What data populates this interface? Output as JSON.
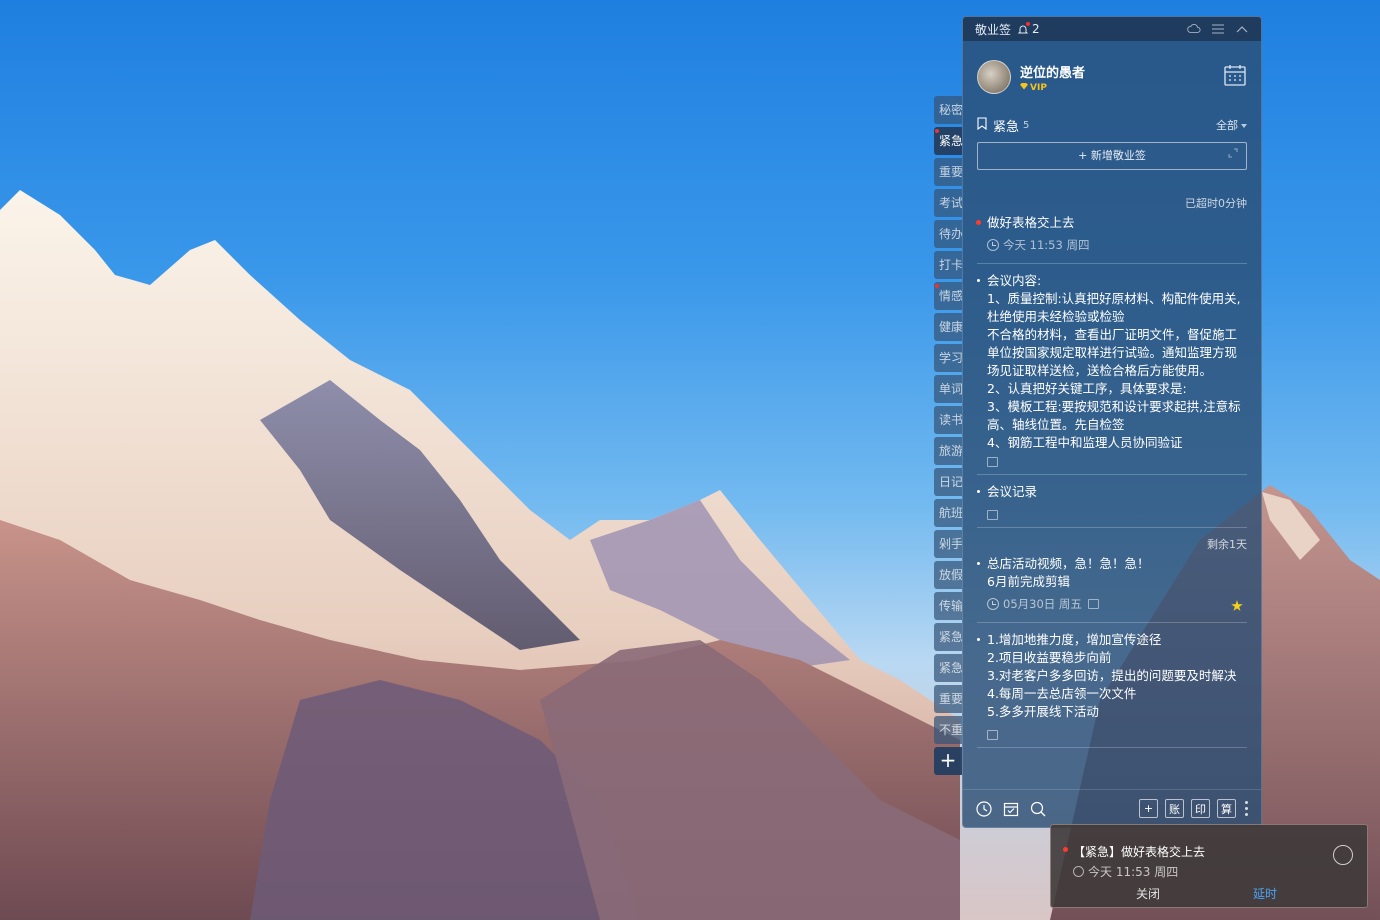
{
  "colors": {
    "accent": "#4aa3f5",
    "urgent_dot": "#ff3b30",
    "star": "#f5d218",
    "vip": "#f5c518"
  },
  "sidebar_tabs": [
    {
      "label": "秘密",
      "active": false,
      "dot": false
    },
    {
      "label": "紧急",
      "active": true,
      "dot": true
    },
    {
      "label": "重要",
      "active": false,
      "dot": false
    },
    {
      "label": "考试",
      "active": false,
      "dot": false
    },
    {
      "label": "待办",
      "active": false,
      "dot": false
    },
    {
      "label": "打卡",
      "active": false,
      "dot": false
    },
    {
      "label": "情感",
      "active": false,
      "dot": true
    },
    {
      "label": "健康",
      "active": false,
      "dot": false
    },
    {
      "label": "学习",
      "active": false,
      "dot": false
    },
    {
      "label": "单词",
      "active": false,
      "dot": false
    },
    {
      "label": "读书",
      "active": false,
      "dot": false
    },
    {
      "label": "旅游",
      "active": false,
      "dot": false
    },
    {
      "label": "日记",
      "active": false,
      "dot": false
    },
    {
      "label": "航班",
      "active": false,
      "dot": false
    },
    {
      "label": "剁手",
      "active": false,
      "dot": false
    },
    {
      "label": "放假",
      "active": false,
      "dot": false
    },
    {
      "label": "传输",
      "active": false,
      "dot": false
    },
    {
      "label": "紧急",
      "active": false,
      "dot": false
    },
    {
      "label": "紧急",
      "active": false,
      "dot": false
    },
    {
      "label": "重要",
      "active": false,
      "dot": false
    },
    {
      "label": "不重",
      "active": false,
      "dot": false
    }
  ],
  "sidebar_add": "+",
  "titlebar": {
    "app_name": "敬业签",
    "notification_count": "2",
    "icons": [
      "cloud-sync-icon",
      "menu-icon",
      "collapse-icon"
    ]
  },
  "user": {
    "name": "逆位的愚者",
    "badge": "VIP"
  },
  "category": {
    "name": "紧急",
    "count": "5",
    "filter": "全部"
  },
  "add_button": "+ 新增敬业签",
  "notes": [
    {
      "meta": "已超时0分钟",
      "text": "做好表格交上去",
      "urgent": true,
      "time": "今天 11:53 周四",
      "attachment": false,
      "star": false
    },
    {
      "meta": "",
      "text": "会议内容:\n1、质量控制:认真把好原材料、构配件使用关,杜绝使用未经检验或检验\n不合格的材料，查看出厂证明文件，督促施工单位按国家规定取样进行试验。通知监理方现场见证取样送检，送检合格后方能使用。\n2、认真把好关键工序，具体要求是:\n3、模板工程:要按规范和设计要求起拱,注意标高、轴线位置。先自检签\n4、钢筋工程中和监理人员协同验证",
      "urgent": false,
      "time": "",
      "attachment": true,
      "star": false
    },
    {
      "meta": "",
      "text": "会议记录",
      "urgent": false,
      "time": "",
      "attachment": true,
      "star": false
    },
    {
      "meta": "剩余1天",
      "text": "总店活动视频，急！急！急！\n6月前完成剪辑",
      "urgent": false,
      "time": "05月30日 周五",
      "attachment": true,
      "star": true
    },
    {
      "meta": "",
      "text": "1.增加地推力度，增加宣传途径\n2.项目收益要稳步向前\n3.对老客户多多回访，提出的问题要及时解决\n4.每周一去总店领一次文件\n5.多多开展线下活动",
      "urgent": false,
      "time": "",
      "attachment": true,
      "star": false
    }
  ],
  "toolbar": {
    "left_icons": [
      "clock-icon",
      "calendar-check-icon",
      "search-icon"
    ],
    "boxed_buttons": [
      "+",
      "账",
      "印",
      "算"
    ]
  },
  "toast": {
    "title": "【紧急】做好表格交上去",
    "time": "今天 11:53 周四",
    "close": "关闭",
    "snooze": "延时"
  }
}
